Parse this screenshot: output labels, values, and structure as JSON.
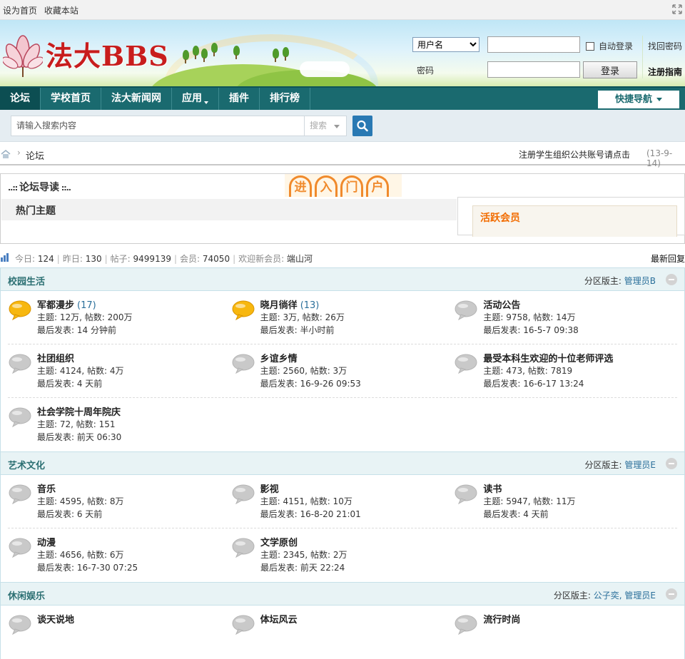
{
  "topbar": {
    "set_home": "设为首页",
    "bookmark": "收藏本站"
  },
  "header": {
    "logo_text": "法大BBS",
    "login": {
      "username_select": "用户名",
      "password_label": "密码",
      "auto_login": "自动登录",
      "login_button": "登录",
      "find_password": "找回密码",
      "register_guide": "注册指南"
    }
  },
  "nav": {
    "items": [
      "论坛",
      "学校首页",
      "法大新闻网",
      "应用",
      "插件",
      "排行榜"
    ],
    "quick_nav": "快捷导航"
  },
  "search": {
    "placeholder": "请输入搜索内容",
    "type": "搜索"
  },
  "breadcrumb": {
    "current": "论坛",
    "notice": "注册学生组织公共账号请点击",
    "date": "(13-9-14)"
  },
  "guide": {
    "title": "论坛导读",
    "portal_chars": [
      "进",
      "入",
      "门",
      "户"
    ],
    "hot_topics": "热门主题",
    "active_members": "活跃会员"
  },
  "stats": {
    "today_label": "今日:",
    "today": "124",
    "yesterday_label": "昨日:",
    "yesterday": "130",
    "posts_label": "帖子:",
    "posts": "9499139",
    "members_label": "会员:",
    "members": "74050",
    "welcome_label": "欢迎新会员:",
    "new_member": "端山河",
    "latest_replies": "最新回复"
  },
  "sections": [
    {
      "name": "校园生活",
      "mods_label": "分区版主:",
      "mods": "管理员B",
      "rows": [
        [
          {
            "name": "军都漫步",
            "new": "(17)",
            "stats": "主题: 12万, 帖数: 200万",
            "last": "最后发表: 14 分钟前",
            "hot": true
          },
          {
            "name": "晓月徜徉",
            "new": "(13)",
            "stats": "主题: 3万, 帖数: 26万",
            "last": "最后发表: 半小时前",
            "hot": true
          },
          {
            "name": "活动公告",
            "new": "",
            "stats": "主题: 9758, 帖数: 14万",
            "last": "最后发表: 16-5-7 09:38",
            "hot": false
          }
        ],
        [
          {
            "name": "社团组织",
            "new": "",
            "stats": "主题: 4124, 帖数: 4万",
            "last": "最后发表: 4 天前",
            "hot": false
          },
          {
            "name": "乡谊乡情",
            "new": "",
            "stats": "主题: 2560, 帖数: 3万",
            "last": "最后发表: 16-9-26 09:53",
            "hot": false
          },
          {
            "name": "最受本科生欢迎的十位老师评选",
            "new": "",
            "stats": "主题: 473, 帖数: 7819",
            "last": "最后发表: 16-6-17 13:24",
            "hot": false
          }
        ],
        [
          {
            "name": "社会学院十周年院庆",
            "new": "",
            "stats": "主题: 72, 帖数: 151",
            "last": "最后发表: 前天 06:30",
            "hot": false
          }
        ]
      ]
    },
    {
      "name": "艺术文化",
      "mods_label": "分区版主:",
      "mods": "管理员E",
      "rows": [
        [
          {
            "name": "音乐",
            "new": "",
            "stats": "主题: 4595, 帖数: 8万",
            "last": "最后发表: 6 天前",
            "hot": false
          },
          {
            "name": "影视",
            "new": "",
            "stats": "主题: 4151, 帖数: 10万",
            "last": "最后发表: 16-8-20 21:01",
            "hot": false
          },
          {
            "name": "读书",
            "new": "",
            "stats": "主题: 5947, 帖数: 11万",
            "last": "最后发表: 4 天前",
            "hot": false
          }
        ],
        [
          {
            "name": "动漫",
            "new": "",
            "stats": "主题: 4656, 帖数: 6万",
            "last": "最后发表: 16-7-30 07:25",
            "hot": false
          },
          {
            "name": "文学原创",
            "new": "",
            "stats": "主题: 2345, 帖数: 2万",
            "last": "最后发表: 前天 22:24",
            "hot": false
          }
        ]
      ]
    },
    {
      "name": "休闲娱乐",
      "mods_label": "分区版主:",
      "mods": "公子奕, 管理员E",
      "rows": [
        [
          {
            "name": "谈天说地",
            "new": "",
            "stats": "",
            "last": "",
            "hot": false
          },
          {
            "name": "体坛风云",
            "new": "",
            "stats": "",
            "last": "",
            "hot": false
          },
          {
            "name": "流行时尚",
            "new": "",
            "stats": "",
            "last": "",
            "hot": false
          }
        ]
      ]
    }
  ],
  "colors": {
    "nav_bg": "#1a6a6f",
    "section_title": "#2b6f72",
    "link": "#2a6f9a",
    "active_member_title": "#f26c00",
    "logo_red": "#c81d1d"
  }
}
